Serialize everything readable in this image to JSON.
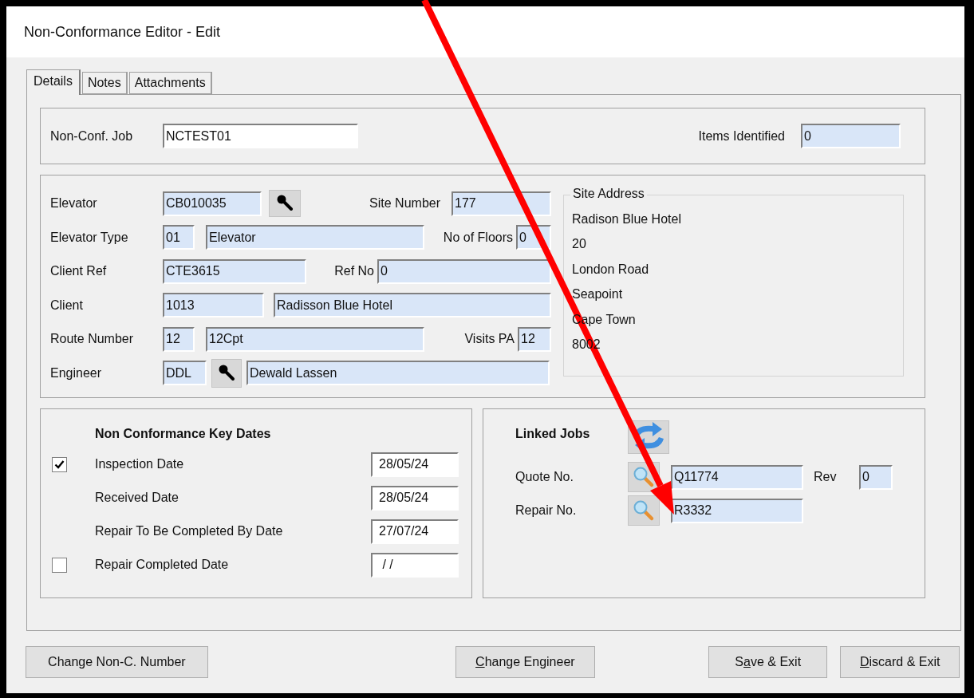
{
  "window": {
    "title": "Non-Conformance Editor - Edit"
  },
  "tabs": [
    {
      "label": "Details",
      "selected": true
    },
    {
      "label": "Notes",
      "selected": false
    },
    {
      "label": "Attachments",
      "selected": false
    }
  ],
  "job": {
    "label": "Non-Conf. Job",
    "value": "NCTEST01"
  },
  "items_identified": {
    "label": "Items Identified",
    "value": "0"
  },
  "details": {
    "elevator": {
      "label": "Elevator",
      "value": "CB010035"
    },
    "site_number": {
      "label": "Site Number",
      "value": "177"
    },
    "elevator_type": {
      "label": "Elevator Type",
      "code": "01",
      "name": "Elevator"
    },
    "floors": {
      "label": "No of Floors",
      "value": "0"
    },
    "client_ref": {
      "label": "Client Ref",
      "value": "CTE3615"
    },
    "ref_no": {
      "label": "Ref No",
      "value": "0"
    },
    "client": {
      "label": "Client",
      "code": "1013",
      "name": "Radisson Blue Hotel"
    },
    "route": {
      "label": "Route Number",
      "code": "12",
      "name": "12Cpt"
    },
    "visits": {
      "label": "Visits PA",
      "value": "12"
    },
    "engineer": {
      "label": "Engineer",
      "code": "DDL",
      "name": "Dewald Lassen"
    }
  },
  "site_address": {
    "title": "Site Address",
    "lines": [
      "Radison Blue Hotel",
      "20",
      "London Road",
      "Seapoint",
      "Cape Town",
      "8002"
    ]
  },
  "key_dates": {
    "title": "Non Conformance Key Dates",
    "rows": [
      {
        "kind": "check",
        "checked": true,
        "label": "Inspection Date",
        "value": "28/05/24"
      },
      {
        "kind": "plain",
        "label": "Received Date",
        "value": "28/05/24"
      },
      {
        "kind": "plain",
        "label": "Repair To Be Completed By Date",
        "value": "27/07/24"
      },
      {
        "kind": "check",
        "checked": false,
        "label": "Repair Completed Date",
        "value": " / /"
      }
    ]
  },
  "linked_jobs": {
    "title": "Linked Jobs",
    "quote": {
      "label": "Quote No.",
      "value": "Q11774"
    },
    "rev": {
      "label": "Rev",
      "value": "0"
    },
    "repair": {
      "label": "Repair No.",
      "value": "R3332"
    }
  },
  "buttons": [
    {
      "segments": [
        {
          "text": "Change Non-C. Number",
          "underlined": false
        }
      ]
    },
    {
      "segments": [
        {
          "text": "C",
          "underlined": true
        },
        {
          "text": "hange Engineer",
          "underlined": false
        }
      ]
    },
    {
      "segments": [
        {
          "text": "S",
          "underlined": false
        },
        {
          "text": "a",
          "underlined": true
        },
        {
          "text": "ve & Exit",
          "underlined": false
        }
      ]
    },
    {
      "segments": [
        {
          "text": "D",
          "underlined": true
        },
        {
          "text": "iscard & Exit",
          "underlined": false
        }
      ]
    }
  ]
}
